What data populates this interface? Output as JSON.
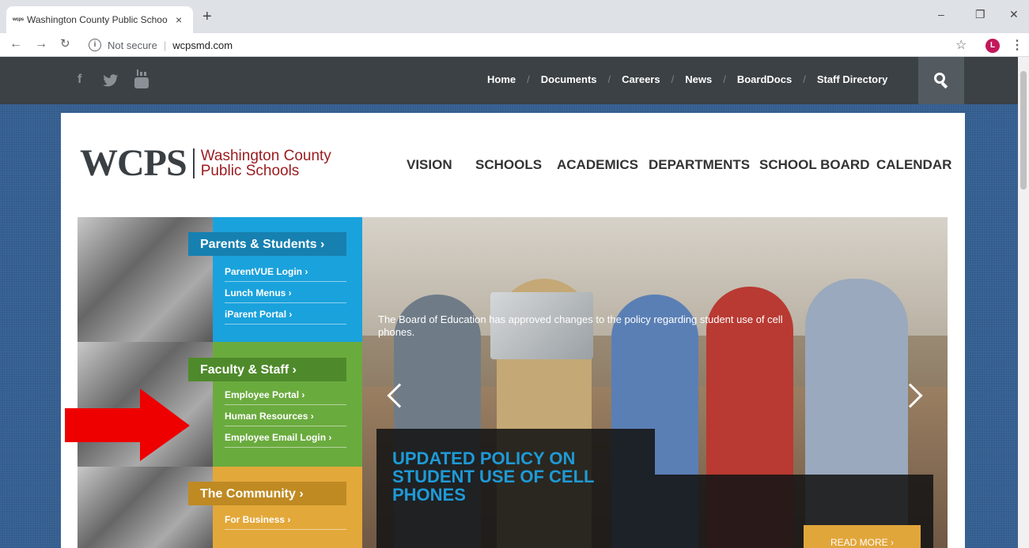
{
  "browser": {
    "tab_title": "Washington County Public Schoo",
    "tab_favicon_text": "wcps",
    "tab_close": "×",
    "new_tab": "+",
    "win_minimize": "–",
    "win_restore": "❐",
    "win_close": "✕",
    "security_label": "Not secure",
    "url": "wcpsmd.com",
    "avatar_letter": "L"
  },
  "topbar": {
    "nav": [
      "Home",
      "Documents",
      "Careers",
      "News",
      "BoardDocs",
      "Staff Directory"
    ],
    "separator": "/",
    "social_icons": [
      "facebook-icon",
      "twitter-icon",
      "youtube-icon"
    ]
  },
  "logo": {
    "abbr": "WCPS",
    "line1": "Washington County",
    "line2": "Public Schools"
  },
  "main_nav": [
    "VISION",
    "SCHOOLS",
    "ACADEMICS",
    "DEPARTMENTS",
    "SCHOOL BOARD",
    "CALENDAR"
  ],
  "quick_links": [
    {
      "heading": "Parents & Students ›",
      "color": "#1aa2dc",
      "head_color": "#1680b0",
      "links": [
        "ParentVUE Login ›",
        "Lunch Menus ›",
        "iParent Portal ›"
      ]
    },
    {
      "heading": "Faculty & Staff ›",
      "color": "#6aab3e",
      "head_color": "#4e8a2b",
      "links": [
        "Employee Portal ›",
        "Human Resources ›",
        "Employee Email Login ›"
      ]
    },
    {
      "heading": "The Community ›",
      "color": "#e3a83a",
      "head_color": "#bf8a22",
      "links": [
        "For Business ›"
      ]
    }
  ],
  "slide": {
    "heading": "UPDATED POLICY ON\nSTUDENT USE OF CELL\nPHONES",
    "text": "The Board of Education has approved changes to the policy regarding student use of cell phones.",
    "read_more": "READ MORE ›"
  },
  "colors": {
    "page_bg": "#335d8f",
    "topbar": "#3b4145",
    "logo_red": "#9b1b1f",
    "slide_heading": "#1e9ad6",
    "annotation_arrow": "#ee0000"
  }
}
